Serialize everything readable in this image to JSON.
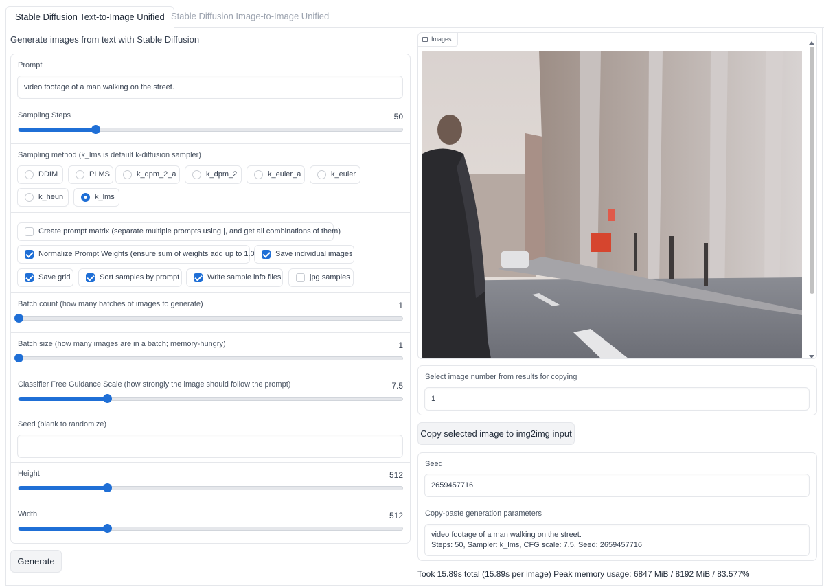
{
  "tabs": [
    {
      "label": "Stable Diffusion Text-to-Image Unified"
    },
    {
      "label": "Stable Diffusion Image-to-Image Unified"
    }
  ],
  "description": "Generate images from text with Stable Diffusion",
  "prompt": {
    "label": "Prompt",
    "value": "video footage of a man walking on the street."
  },
  "sampling_steps": {
    "label": "Sampling Steps",
    "value": "50",
    "fraction": 0.2
  },
  "sampling_method": {
    "label": "Sampling method (k_lms is default k-diffusion sampler)",
    "options": [
      "DDIM",
      "PLMS",
      "k_dpm_2_a",
      "k_dpm_2",
      "k_euler_a",
      "k_euler",
      "k_heun",
      "k_lms"
    ],
    "selected": "k_lms"
  },
  "options": [
    {
      "label": "Create prompt matrix (separate multiple prompts using |, and get all combinations of them)",
      "checked": false
    },
    {
      "label": "Normalize Prompt Weights (ensure sum of weights add up to 1.0)",
      "checked": true
    },
    {
      "label": "Save individual images",
      "checked": true
    },
    {
      "label": "Save grid",
      "checked": true
    },
    {
      "label": "Sort samples by prompt",
      "checked": true
    },
    {
      "label": "Write sample info files",
      "checked": true
    },
    {
      "label": "jpg samples",
      "checked": false
    }
  ],
  "batch_count": {
    "label": "Batch count (how many batches of images to generate)",
    "value": "1",
    "fraction": 0.0
  },
  "batch_size": {
    "label": "Batch size (how many images are in a batch; memory-hungry)",
    "value": "1",
    "fraction": 0.0
  },
  "cfg_scale": {
    "label": "Classifier Free Guidance Scale (how strongly the image should follow the prompt)",
    "value": "7.5",
    "fraction": 0.23
  },
  "seed_input": {
    "label": "Seed (blank to randomize)",
    "value": ""
  },
  "height": {
    "label": "Height",
    "value": "512",
    "fraction": 0.23
  },
  "width": {
    "label": "Width",
    "value": "512",
    "fraction": 0.23
  },
  "generate_label": "Generate",
  "gallery": {
    "label": "Images"
  },
  "select_image": {
    "label": "Select image number from results for copying",
    "value": "1"
  },
  "copy_button_label": "Copy selected image to img2img input",
  "seed_output": {
    "label": "Seed",
    "value": "2659457716"
  },
  "params": {
    "label": "Copy-paste generation parameters",
    "line1": "video footage of a man walking on the street.",
    "line2": "Steps: 50, Sampler: k_lms, CFG scale: 7.5, Seed: 2659457716"
  },
  "status": "Took 15.89s total (15.89s per image) Peak memory usage: 6847 MiB / 8192 MiB / 83.577%",
  "colors": {
    "accent": "#1f6fd6",
    "border": "#e5e7eb"
  }
}
